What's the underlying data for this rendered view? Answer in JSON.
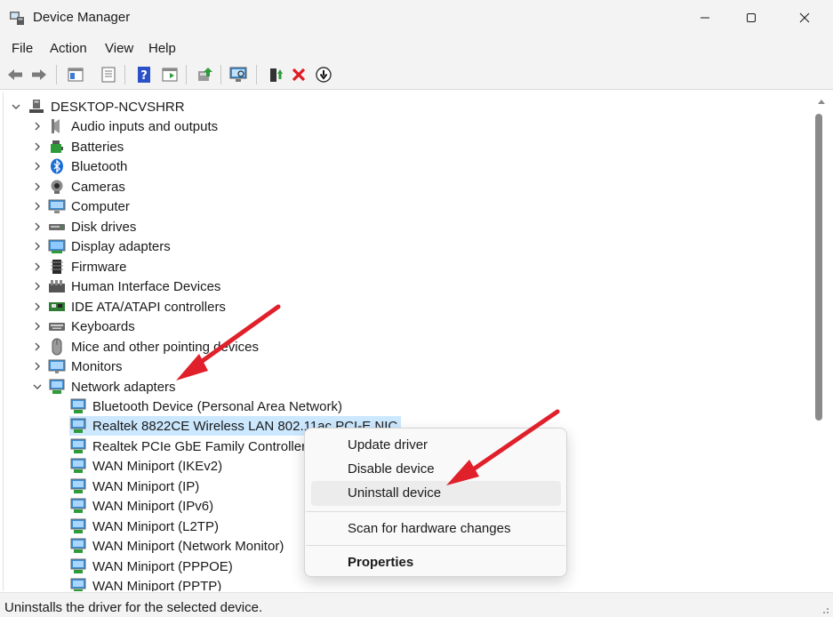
{
  "window": {
    "title": "Device Manager"
  },
  "menu": [
    "File",
    "Action",
    "View",
    "Help"
  ],
  "toolbar": {
    "icons": [
      "back-icon",
      "forward-icon",
      "show-hide-tree-icon",
      "properties-icon",
      "help-icon",
      "action-pane-icon",
      "update-driver-icon",
      "scan-hardware-icon",
      "add-driver-icon",
      "uninstall-icon",
      "disable-icon"
    ]
  },
  "tree": {
    "root": "DESKTOP-NCVSHRR",
    "categories": [
      {
        "label": "Audio inputs and outputs",
        "icon": "speaker-icon"
      },
      {
        "label": "Batteries",
        "icon": "battery-icon"
      },
      {
        "label": "Bluetooth",
        "icon": "bluetooth-icon"
      },
      {
        "label": "Cameras",
        "icon": "camera-icon"
      },
      {
        "label": "Computer",
        "icon": "computer-icon"
      },
      {
        "label": "Disk drives",
        "icon": "disk-drive-icon"
      },
      {
        "label": "Display adapters",
        "icon": "display-adapter-icon"
      },
      {
        "label": "Firmware",
        "icon": "firmware-icon"
      },
      {
        "label": "Human Interface Devices",
        "icon": "hid-icon"
      },
      {
        "label": "IDE ATA/ATAPI controllers",
        "icon": "ide-controller-icon"
      },
      {
        "label": "Keyboards",
        "icon": "keyboard-icon"
      },
      {
        "label": "Mice and other pointing devices",
        "icon": "mouse-icon"
      },
      {
        "label": "Monitors",
        "icon": "monitor-icon"
      },
      {
        "label": "Network adapters",
        "icon": "network-adapter-icon",
        "expanded": true
      }
    ],
    "network_children": [
      "Bluetooth Device (Personal Area Network)",
      "Realtek 8822CE Wireless LAN 802.11ac PCI-E NIC",
      "Realtek PCIe GbE Family Controller",
      "WAN Miniport (IKEv2)",
      "WAN Miniport (IP)",
      "WAN Miniport (IPv6)",
      "WAN Miniport (L2TP)",
      "WAN Miniport (Network Monitor)",
      "WAN Miniport (PPPOE)",
      "WAN Miniport (PPTP)"
    ],
    "selected_index": 1
  },
  "context_menu": {
    "update": "Update driver",
    "disable": "Disable device",
    "uninstall": "Uninstall device",
    "scan": "Scan for hardware changes",
    "properties": "Properties"
  },
  "status": "Uninstalls the driver for the selected device.",
  "colors": {
    "selection": "#cce8ff",
    "annotation_arrow": "#e0202a"
  }
}
